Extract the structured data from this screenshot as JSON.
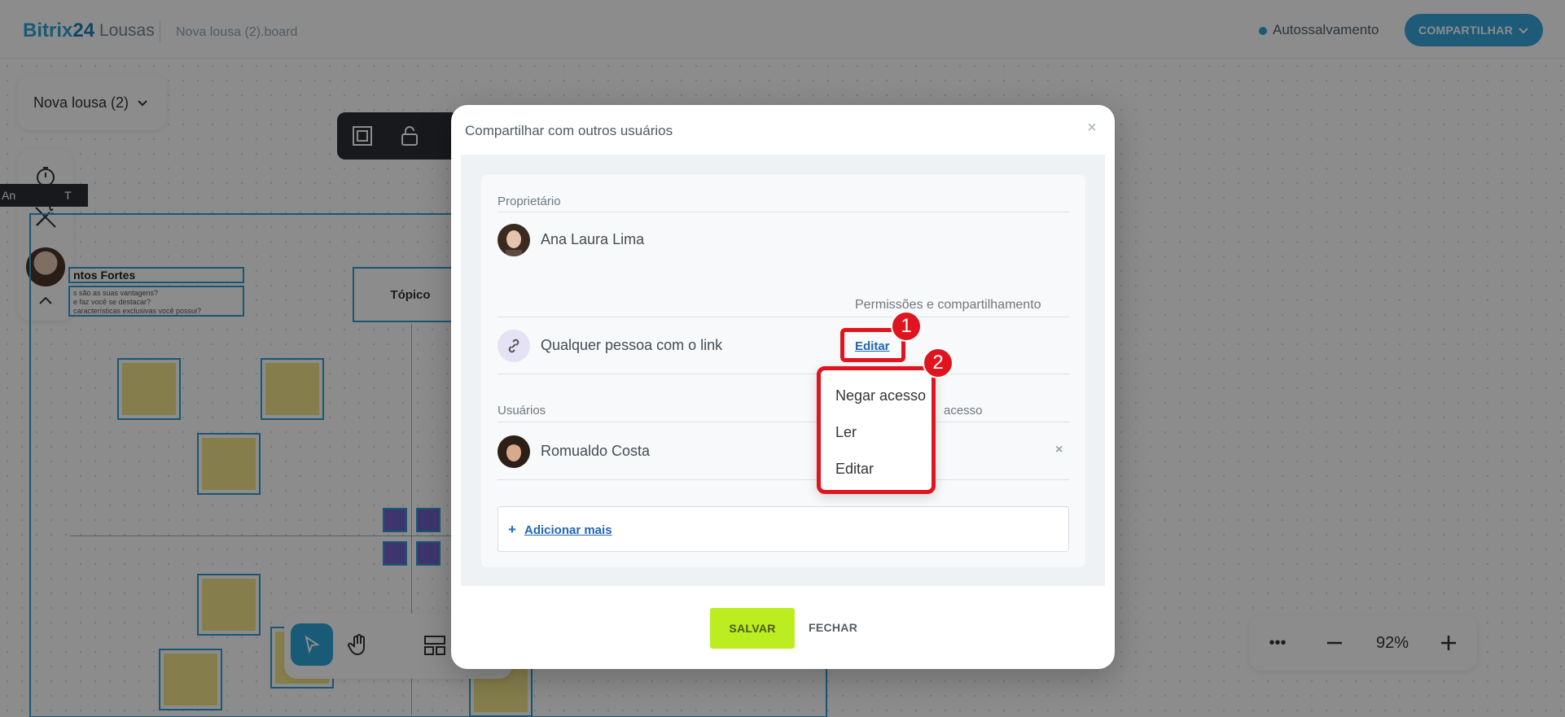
{
  "app": {
    "logo_brand": "Bitrix",
    "logo_number": "24",
    "logo_product": "Lousas",
    "file_name": "Nova lousa (2).board",
    "autosave_label": "Autossalvamento",
    "share_label": "COMPARTILHAR"
  },
  "board": {
    "name": "Nova lousa (2)",
    "tag_text": "An",
    "tag_suffix": "T",
    "swot_title": "ntos Fortes",
    "swot_lines": [
      "s são as suas vantagens?",
      "e faz você se destacar?",
      "características exclusivas você possui?"
    ],
    "topic_label": "Tópico",
    "zoom_level": "92%"
  },
  "modal": {
    "title": "Compartilhar com outros usuários",
    "owner_label": "Proprietário",
    "owner_name": "Ana Laura Lima",
    "permissions_label": "Permissões e compartilhamento",
    "link_access_label": "Qualquer pessoa com o link",
    "link_access_permission": "Editar",
    "users_label": "Usuários",
    "users_permission_label_partial": "acesso",
    "user_name": "Romualdo Costa",
    "add_more_label": "Adicionar mais",
    "save_label": "SALVAR",
    "close_label": "FECHAR"
  },
  "dropdown": {
    "options": [
      "Negar acesso",
      "Ler",
      "Editar"
    ]
  },
  "annotations": {
    "badge_1": "1",
    "badge_2": "2"
  },
  "colors": {
    "accent": "#2fa5d8",
    "save_button": "#bbed21",
    "highlight": "#e0141e",
    "link": "#2067b0"
  }
}
